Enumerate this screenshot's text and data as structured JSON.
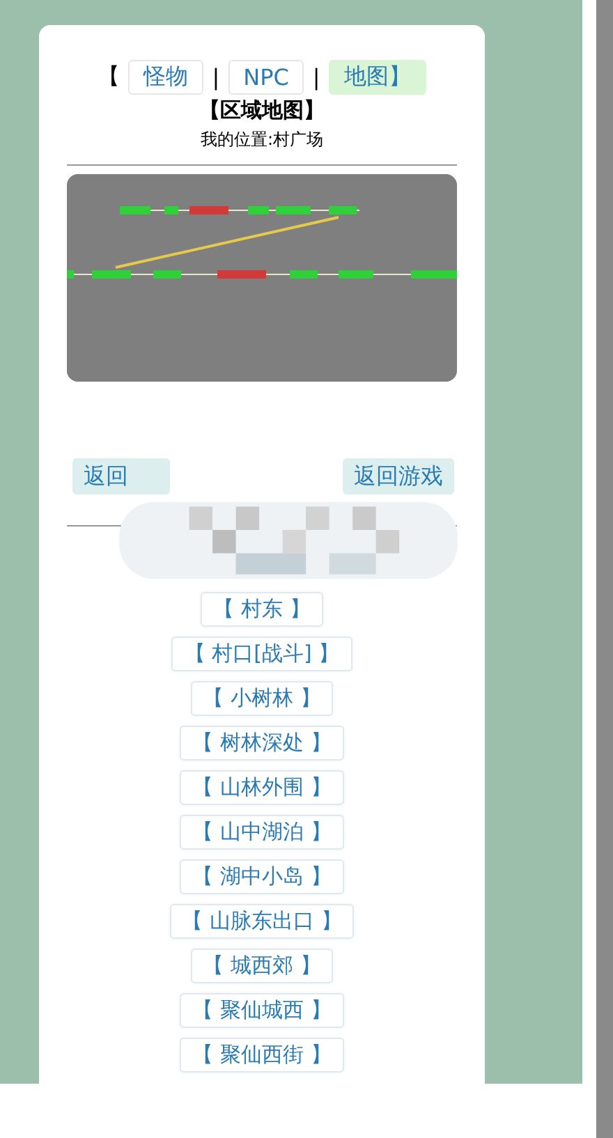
{
  "open_bracket": "【",
  "tabs": [
    {
      "label": "怪物",
      "selected": false
    },
    {
      "label": "NPC",
      "selected": false
    },
    {
      "label": "地图】",
      "selected": true
    }
  ],
  "separator": "|",
  "title": "【区域地图】",
  "location": "我的位置:村广场",
  "nav_buttons": [
    "返回",
    "返回游戏"
  ],
  "places": [
    "【 村东 】",
    "【 村口[战斗] 】",
    "【 小树林 】",
    "【 树林深处 】",
    "【 山林外围 】",
    "【 山中湖泊 】",
    "【 湖中小岛 】",
    "【 山脉东出口 】",
    "【 城西郊 】",
    "【 聚仙城西 】",
    "【 聚仙西街 】"
  ]
}
